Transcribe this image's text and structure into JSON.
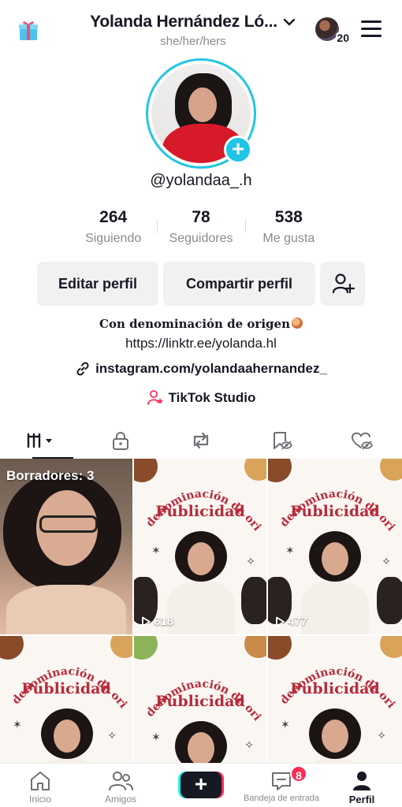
{
  "header": {
    "name": "Yolanda Hernández Ló...",
    "pronouns": "she/her/hers",
    "account_switch_count": "20"
  },
  "profile": {
    "handle": "@yolandaa_.h",
    "stats": [
      {
        "value": "264",
        "label": "Siguiendo"
      },
      {
        "value": "78",
        "label": "Seguidores"
      },
      {
        "value": "538",
        "label": "Me gusta"
      }
    ],
    "buttons": {
      "edit": "Editar perfil",
      "share": "Compartir perfil"
    },
    "bio_line1": "Con denominación de origen",
    "bio_line2": "https://linktr.ee/yolanda.hl",
    "link": "instagram.com/yolandaahernandez_",
    "studio": "TikTok Studio"
  },
  "tabs": [
    {
      "name": "videos",
      "icon": "grid-columns-icon",
      "active": true
    },
    {
      "name": "private",
      "icon": "lock-icon",
      "active": false
    },
    {
      "name": "reposts",
      "icon": "repost-icon",
      "active": false
    },
    {
      "name": "favorites",
      "icon": "bookmark-eye-icon",
      "active": false
    },
    {
      "name": "liked",
      "icon": "heart-eye-icon",
      "active": false
    }
  ],
  "grid": {
    "drafts_label": "Borradores: 3",
    "promo_arc_text": "Con denominación de origen",
    "promo_title": "Publicidad",
    "views": [
      "618",
      "477"
    ]
  },
  "bottom_nav": {
    "home": "Inicio",
    "friends": "Amigos",
    "create": "+",
    "inbox": "Bandeja de entrada",
    "inbox_badge": "8",
    "profile": "Perfil"
  },
  "colors": {
    "accent_cyan": "#20c4e6",
    "tiktok_red": "#fe2c55",
    "promo_red": "#b72b3a"
  }
}
